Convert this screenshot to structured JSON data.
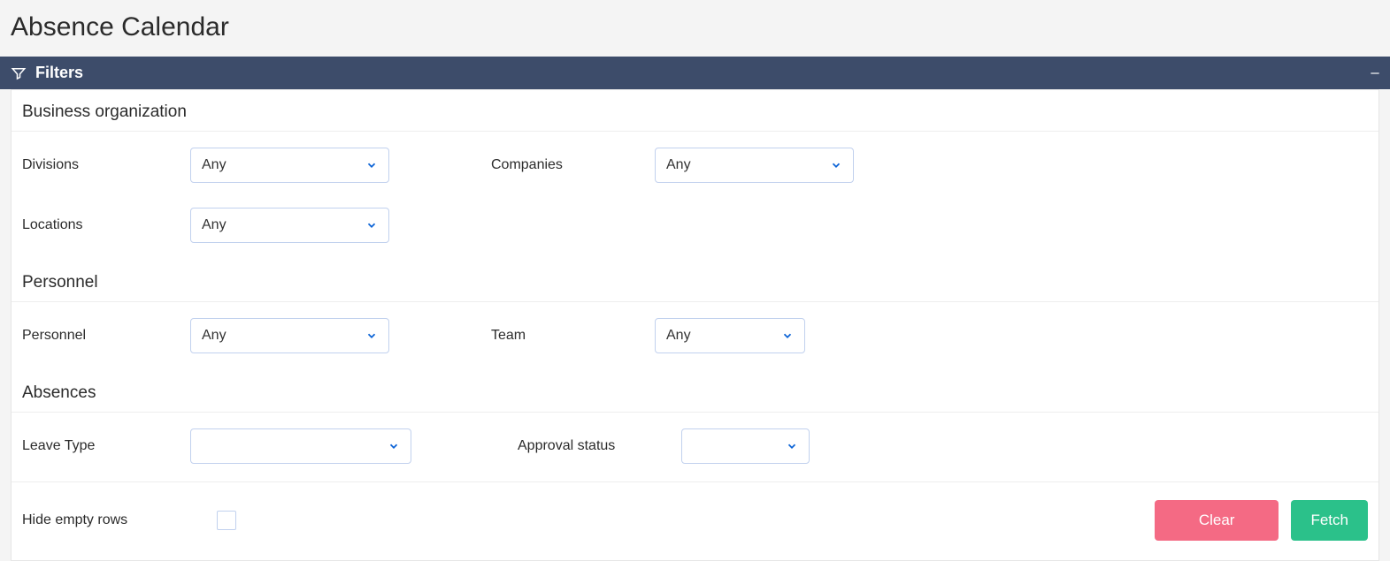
{
  "page": {
    "title": "Absence Calendar"
  },
  "filters_bar": {
    "label": "Filters"
  },
  "sections": {
    "business_org": {
      "title": "Business organization",
      "divisions": {
        "label": "Divisions",
        "value": "Any"
      },
      "companies": {
        "label": "Companies",
        "value": "Any"
      },
      "locations": {
        "label": "Locations",
        "value": "Any"
      }
    },
    "personnel": {
      "title": "Personnel",
      "personnel": {
        "label": "Personnel",
        "value": "Any"
      },
      "team": {
        "label": "Team",
        "value": "Any"
      }
    },
    "absences": {
      "title": "Absences",
      "leave_type": {
        "label": "Leave Type",
        "value": ""
      },
      "approval_status": {
        "label": "Approval status",
        "value": ""
      }
    }
  },
  "footer": {
    "hide_empty_rows": {
      "label": "Hide empty rows",
      "checked": false
    },
    "clear": "Clear",
    "fetch": "Fetch"
  }
}
